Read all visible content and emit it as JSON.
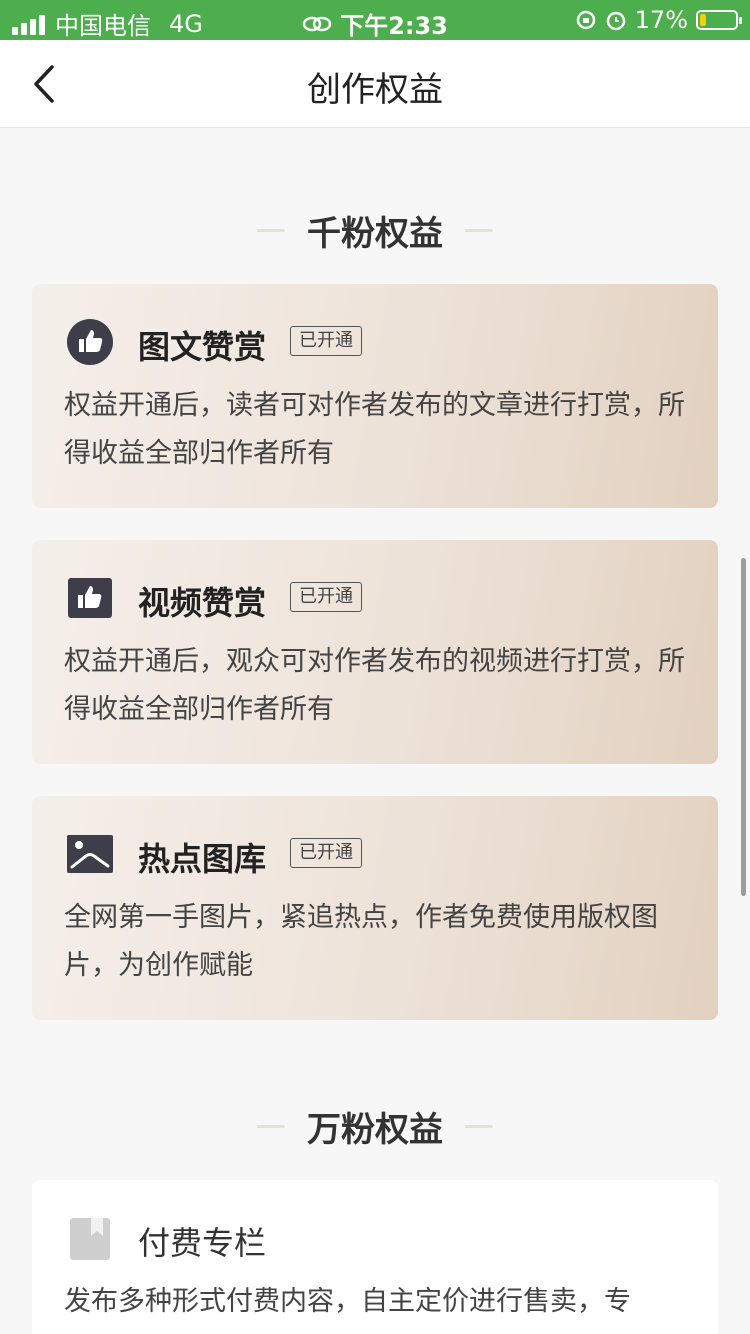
{
  "status_bar": {
    "carrier": "中国电信",
    "network": "4G",
    "time": "下午2:33",
    "battery": "17%"
  },
  "nav": {
    "title": "创作权益"
  },
  "sections": [
    {
      "title": "千粉权益",
      "cards": [
        {
          "title": "图文赞赏",
          "badge": "已开通",
          "desc": "权益开通后，读者可对作者发布的文章进行打赏，所得收益全部归作者所有",
          "icon": "thumbs-up-circle-icon"
        },
        {
          "title": "视频赞赏",
          "badge": "已开通",
          "desc": "权益开通后，观众可对作者发布的视频进行打赏，所得收益全部归作者所有",
          "icon": "thumbs-up-square-icon"
        },
        {
          "title": "热点图库",
          "badge": "已开通",
          "desc": "全网第一手图片，紧追热点，作者免费使用版权图片，为创作赋能",
          "icon": "image-icon"
        }
      ]
    },
    {
      "title": "万粉权益",
      "cards": [
        {
          "title": "付费专栏",
          "desc": "发布多种形式付费内容，自主定价进行售卖，专",
          "icon": "bookmark-icon"
        }
      ]
    }
  ],
  "colors": {
    "status_bar_bg": "#4cae4c",
    "card_gradient_start": "#f5efea",
    "card_gradient_end": "#e2d1c0"
  }
}
